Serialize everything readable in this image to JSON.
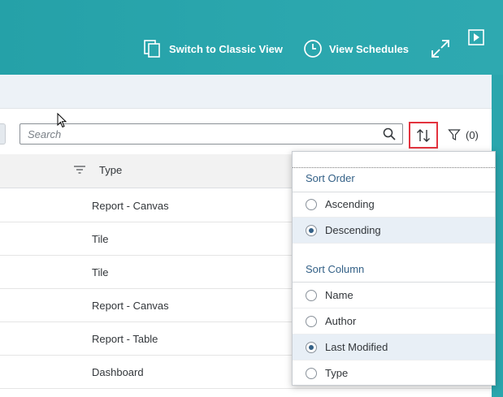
{
  "header": {
    "switch_classic_label": "Switch to Classic View",
    "view_schedules_label": "View Schedules",
    "icons": {
      "switch_classic": "copy-pages-icon",
      "view_schedules": "clock-icon",
      "expand": "expand-icon",
      "present": "play-icon"
    }
  },
  "toolbar": {
    "search_placeholder": "Search",
    "filter_count": "(0)",
    "icons": {
      "search": "search-icon",
      "sort": "sort-arrows-icon",
      "filter": "filter-funnel-icon"
    }
  },
  "table": {
    "type_header": "Type",
    "rows": [
      {
        "type": "Report - Canvas"
      },
      {
        "type": "Tile"
      },
      {
        "type": "Tile"
      },
      {
        "type": "Report - Canvas"
      },
      {
        "type": "Report - Table"
      },
      {
        "type": "Dashboard"
      }
    ]
  },
  "sort_popover": {
    "order_title": "Sort Order",
    "order_options": [
      {
        "label": "Ascending",
        "selected": false
      },
      {
        "label": "Descending",
        "selected": true
      }
    ],
    "column_title": "Sort Column",
    "column_options": [
      {
        "label": "Name",
        "selected": false
      },
      {
        "label": "Author",
        "selected": false
      },
      {
        "label": "Last Modified",
        "selected": true
      },
      {
        "label": "Type",
        "selected": false
      }
    ]
  },
  "colors": {
    "header_bg": "#2aa6ad",
    "accent": "#346187",
    "highlight_border": "#e3333e",
    "selected_row": "#e8eff6"
  }
}
